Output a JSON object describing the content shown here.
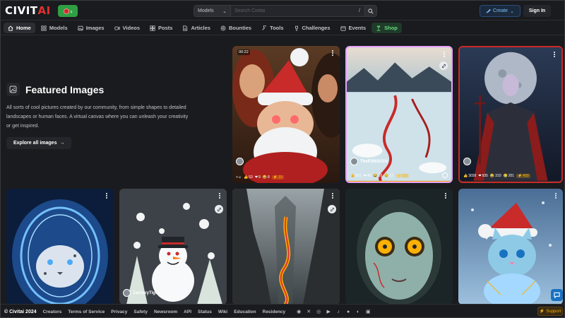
{
  "brand": {
    "logo_main": "CIVIT",
    "logo_accent": "AI"
  },
  "search": {
    "category": "Models",
    "placeholder": "Search Civitai",
    "shortcut": "/"
  },
  "header": {
    "create_label": "Create",
    "signin_label": "Sign In"
  },
  "nav": [
    {
      "label": "Home",
      "icon": "home-icon",
      "active": true
    },
    {
      "label": "Models",
      "icon": "models-icon"
    },
    {
      "label": "Images",
      "icon": "images-icon"
    },
    {
      "label": "Videos",
      "icon": "video-icon"
    },
    {
      "label": "Posts",
      "icon": "posts-icon"
    },
    {
      "label": "Articles",
      "icon": "articles-icon"
    },
    {
      "label": "Bounties",
      "icon": "bounties-icon"
    },
    {
      "label": "Tools",
      "icon": "tools-icon"
    },
    {
      "label": "Challenges",
      "icon": "challenges-icon"
    },
    {
      "label": "Events",
      "icon": "events-icon"
    },
    {
      "label": "Shop",
      "icon": "shop-icon"
    }
  ],
  "featured": {
    "title": "Featured Images",
    "description": "All sorts of cool pictures created by our community, from simple shapes to detailed landscapes or human faces. A virtual canvas where you can unleash your creativity or get inspired.",
    "cta": "Explore all images"
  },
  "cards": [
    {
      "subject": "santa-video",
      "time": "00:22",
      "username": "",
      "stats": {
        "likes": "53",
        "hearts": "9",
        "laughs": "8",
        "buzz": "10"
      }
    },
    {
      "subject": "frozen-lake",
      "username": "TheP3NGU1N",
      "stats": {
        "likes": "161",
        "hearts": "46",
        "laughs": "18",
        "cries": "17",
        "buzz": "115"
      }
    },
    {
      "subject": "dark-knight",
      "username": "",
      "stats": {
        "likes": "3036",
        "hearts": "935",
        "laughs": "310",
        "cries": "201",
        "buzz": "459"
      }
    },
    {
      "subject": "snow-leopard",
      "username": ""
    },
    {
      "subject": "snowman",
      "username": "ZacharyTiger"
    },
    {
      "subject": "canyon-river",
      "username": ""
    },
    {
      "subject": "golden-eyes",
      "username": ""
    },
    {
      "subject": "santa-kitten",
      "username": ""
    }
  ],
  "footer": {
    "copyright": "© Civitai 2024",
    "links": [
      "Creators",
      "Terms of Service",
      "Privacy",
      "Safety",
      "Newsroom",
      "API",
      "Status",
      "Wiki",
      "Education",
      "Residency"
    ],
    "support": "Support"
  },
  "colors": {
    "accent": "#e03131",
    "create": "#74c0fc",
    "shop": "#69db7c",
    "buzz": "#fab005"
  }
}
